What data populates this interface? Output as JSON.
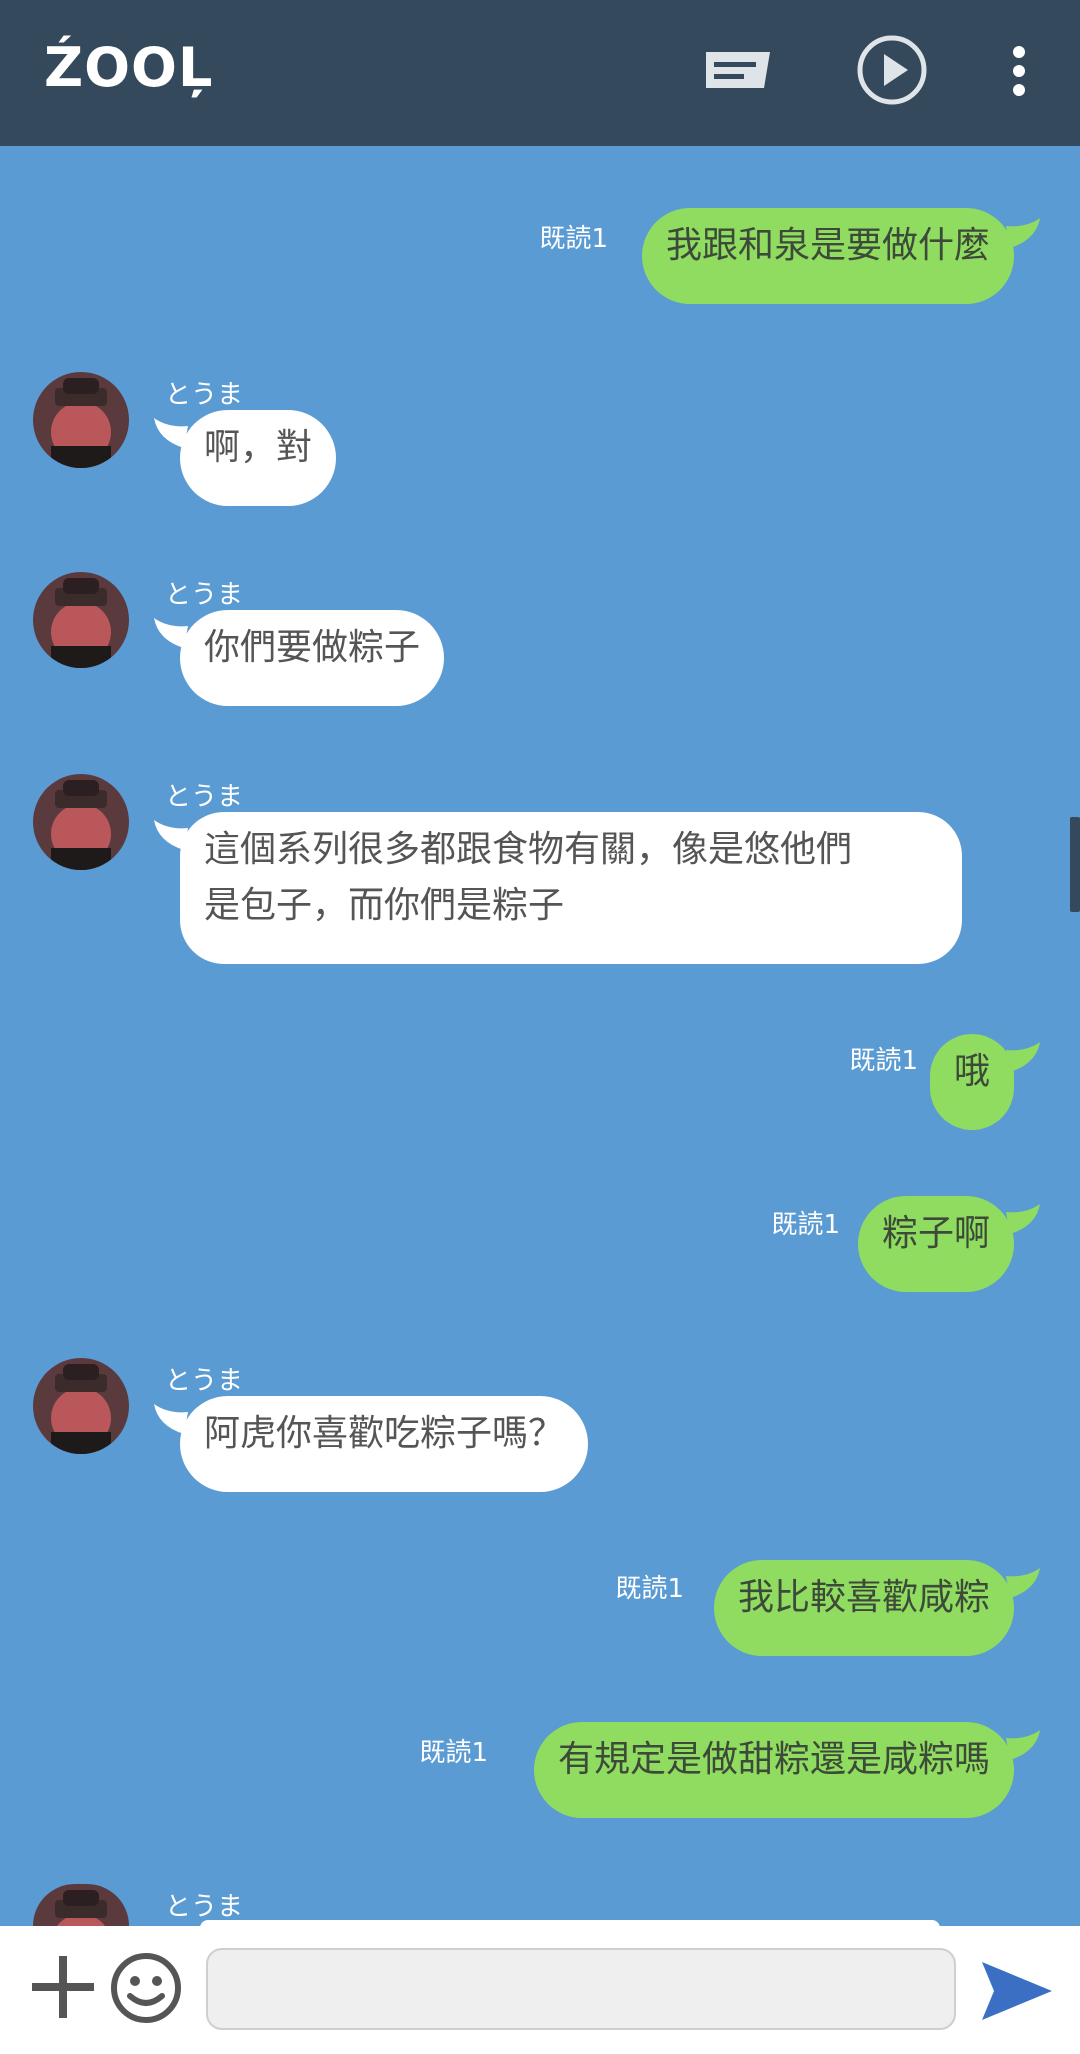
{
  "header": {
    "title": "ŹOOĻ",
    "icons": [
      "keyboard-menu-icon",
      "play-icon",
      "more-vert-icon"
    ]
  },
  "messages": [
    {
      "side": "out",
      "text": "我跟和泉是要做什麼",
      "read": "既読1"
    },
    {
      "side": "in",
      "sender": "とうま",
      "text": "啊，對"
    },
    {
      "side": "in",
      "sender": "とうま",
      "text": "你們要做粽子"
    },
    {
      "side": "in",
      "sender": "とうま",
      "text_line1": "這個系列很多都跟食物有關，像是悠他們",
      "text_line2": "是包子，而你們是粽子"
    },
    {
      "side": "out",
      "text": "哦",
      "read": "既読1"
    },
    {
      "side": "out",
      "text": "粽子啊",
      "read": "既読1"
    },
    {
      "side": "in",
      "sender": "とうま",
      "text": "阿虎你喜歡吃粽子嗎？"
    },
    {
      "side": "out",
      "text": "我比較喜歡咸粽",
      "read": "既読1"
    },
    {
      "side": "out",
      "text": "有規定是做甜粽還是咸粽嗎",
      "read": "既読1"
    },
    {
      "side": "in",
      "sender": "とうま",
      "text": ""
    }
  ],
  "composer": {
    "placeholder": "",
    "icons": [
      "plus-icon",
      "emoji-icon",
      "send-icon"
    ]
  },
  "colors": {
    "header": "#34495c",
    "background": "#5b9bd3",
    "outgoing": "#8fdc60",
    "incoming": "#ffffff",
    "send": "#3a6fc4"
  }
}
